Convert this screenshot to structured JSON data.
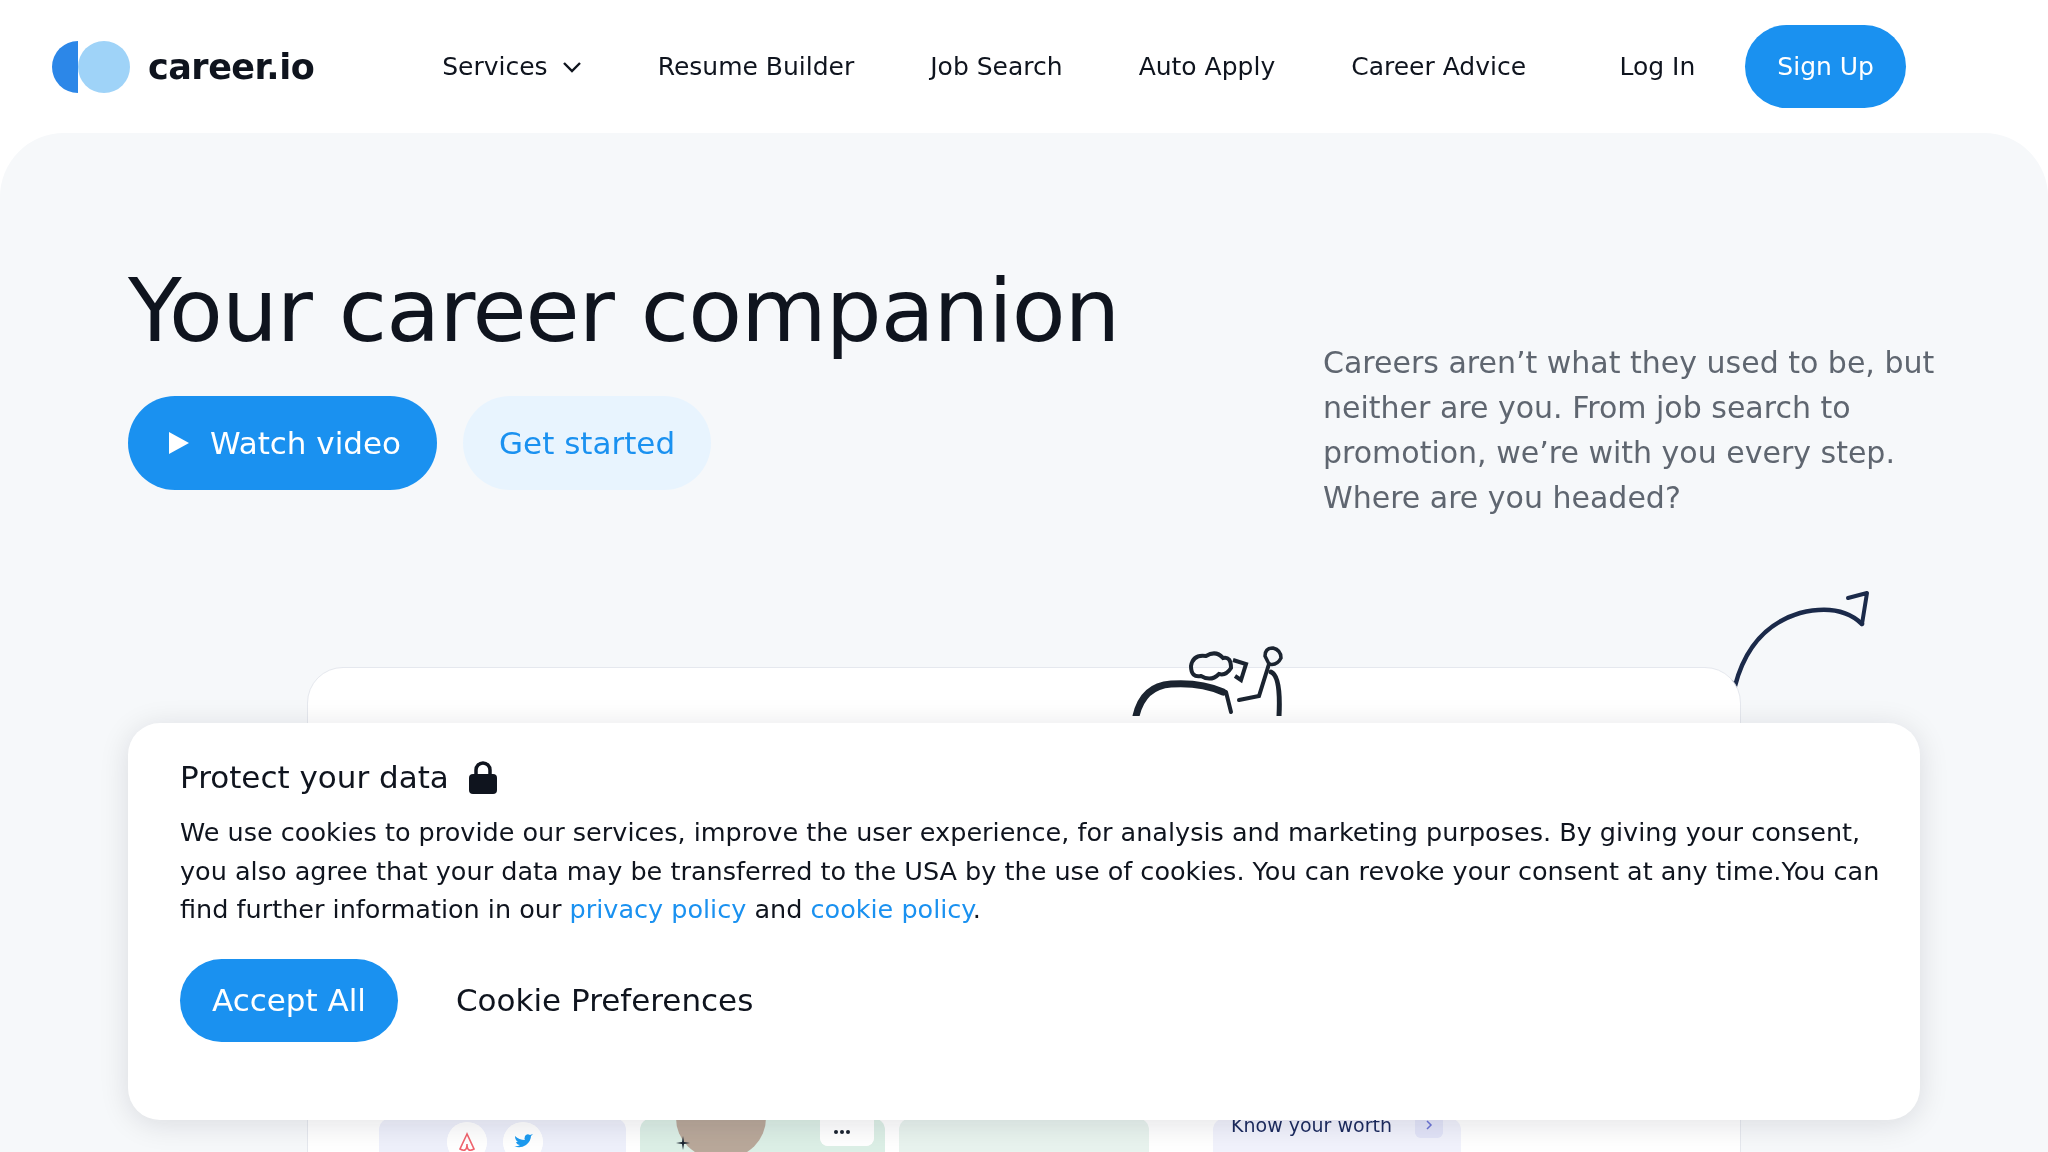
{
  "logo": {
    "text": "career.io"
  },
  "nav": [
    {
      "label": "Services",
      "kind": "dropdown"
    },
    {
      "label": "Resume Builder",
      "kind": "link"
    },
    {
      "label": "Job Search",
      "kind": "link"
    },
    {
      "label": "Auto Apply",
      "kind": "link"
    },
    {
      "label": "Career Advice",
      "kind": "link"
    }
  ],
  "auth": {
    "login": "Log In",
    "signup": "Sign Up"
  },
  "hero": {
    "title": "Your career companion",
    "buttons": [
      {
        "label": "Watch video",
        "kind": "primary"
      },
      {
        "label": "Get started",
        "kind": "secondary"
      }
    ],
    "description": "Careers aren’t what they used to be, but neither are you. From job search to promotion, we’re with you every step. Where are you headed?"
  },
  "preview": {
    "tiles": [
      {
        "kind": "social"
      },
      {
        "kind": "photo"
      },
      {
        "kind": "plain"
      },
      {
        "kind": "link",
        "label": "Know your worth"
      }
    ]
  },
  "cookie_dialog": {
    "title": "Protect your data",
    "text": [
      {
        "kind": "text",
        "text": "We use cookies to provide our services, improve the user experience, for analysis and marketing purposes. By giving your consent, you also agree that your data may be transferred to the USA by the use of cookies. You can revoke your consent at any time.You can find further information in our "
      },
      {
        "kind": "link",
        "text": "privacy policy"
      },
      {
        "kind": "text",
        "text": " and "
      },
      {
        "kind": "link",
        "text": "cookie policy"
      },
      {
        "kind": "text",
        "text": "."
      }
    ],
    "buttons": [
      {
        "label": "Accept All",
        "kind": "primary"
      },
      {
        "label": "Cookie Preferences",
        "kind": "plain"
      }
    ]
  }
}
